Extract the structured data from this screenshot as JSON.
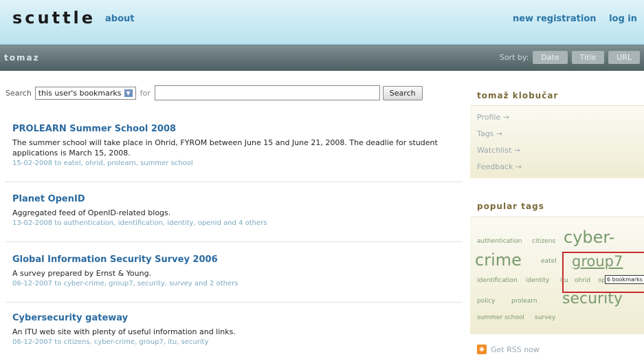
{
  "header": {
    "logo": "scuttle",
    "about": "about",
    "new_registration": "new registration",
    "log_in": "log in"
  },
  "user_bar": {
    "username": "tomaz",
    "sort_label": "Sort by:",
    "sort_options": [
      "Date",
      "Title",
      "URL"
    ]
  },
  "search": {
    "label": "Search",
    "scope": "this user's bookmarks",
    "for": "for",
    "query": "",
    "button": "Search"
  },
  "bookmarks": [
    {
      "title": "PROLEARN Summer School 2008",
      "description": "The summer school will take place in Ohrid, FYROM between June 15 and June 21, 2008. The deadlie for student applications is March 15, 2008.",
      "meta": "15-02-2008 to eatel, ohrid, prolearn, summer school"
    },
    {
      "title": "Planet OpenID",
      "description": "Aggregated feed of OpenID-related blogs.",
      "meta": "13-02-2008 to authentication, identification, identity, openid and 4 others"
    },
    {
      "title": "Global Information Security Survey 2006",
      "description": "A survey prepared by Ernst & Young.",
      "meta": "06-12-2007 to cyber-crime, group7, security, survey and 2 others"
    },
    {
      "title": "Cybersecurity gateway",
      "description": "An ITU web site with plenty of useful information and links.",
      "meta": "06-12-2007 to citizens, cyber-crime, group7, itu, security"
    }
  ],
  "sidebar": {
    "user_name": "tomaž klobučar",
    "links": [
      "Profile →",
      "Tags →",
      "Watchlist →",
      "Feedback →"
    ],
    "popular_tags_title": "popular tags",
    "tags": [
      "authentication",
      "citizens",
      "cyber-",
      "crime",
      "eatel",
      "group7",
      "identification",
      "identity",
      "itu",
      "ohrid",
      "openid",
      "policy",
      "prolearn",
      "security",
      "summer school",
      "survey"
    ],
    "tooltip": "6 bookmarks",
    "rss": "Get RSS now"
  },
  "colors": {
    "link": "#2a6aa0",
    "tag": "#7a9a6e",
    "highlight": "#c62a2a"
  }
}
